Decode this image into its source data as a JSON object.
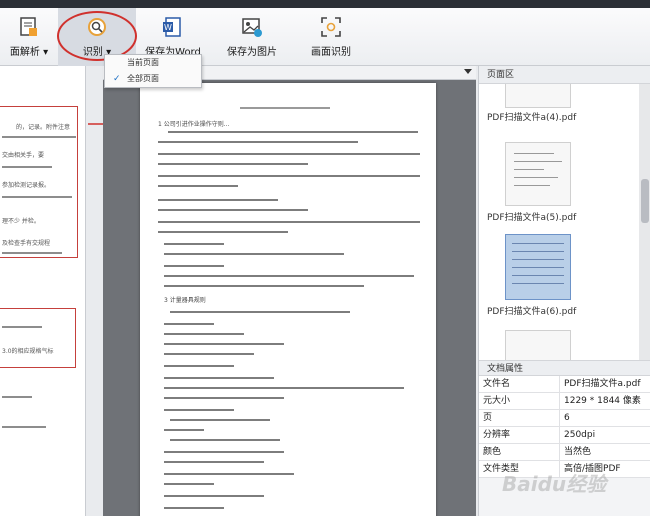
{
  "toolbar": {
    "page_parse": "面解析",
    "recognize": "识别",
    "save_word": "保存为Word",
    "save_image": "保存为图片",
    "screen_ocr": "画面识别"
  },
  "dropdown": {
    "items": [
      "当前页面",
      "全部页面"
    ]
  },
  "pages_panel": {
    "title": "页面区",
    "thumbnails": [
      {
        "label": "PDF扫描文件a(4).pdf",
        "selected": false
      },
      {
        "label": "PDF扫描文件a(5).pdf",
        "selected": false
      },
      {
        "label": "PDF扫描文件a(6).pdf",
        "selected": true
      },
      {
        "label": "",
        "selected": false
      }
    ]
  },
  "doc_props": {
    "title": "文档属性",
    "rows": [
      {
        "key": "文件名",
        "value": "PDF扫描文件a.pdf"
      },
      {
        "key": "元大小",
        "value": "1229 * 1844 像素"
      },
      {
        "key": "页",
        "value": "6"
      },
      {
        "key": "分辨率",
        "value": "250dpi"
      },
      {
        "key": "颜色",
        "value": "当然色"
      },
      {
        "key": "文件类型",
        "value": "高倍/插图PDF"
      }
    ]
  },
  "document": {
    "header_text": "1 公司引进作业操作守则...",
    "section_text": "3 计量器具规则"
  },
  "left_strip": {
    "snippets": [
      "的，记录。附件注意",
      "交由相关手，要",
      "参加检测记录报。",
      "理不少 并检。",
      "及检查手有交规程",
      "3.0的相应规格气标"
    ]
  },
  "watermark": "Baidu经验",
  "colors": {
    "accent": "#d0312d",
    "selection": "#b9cfe8"
  }
}
